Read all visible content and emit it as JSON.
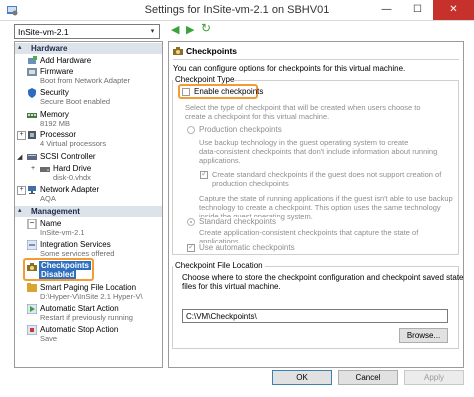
{
  "window": {
    "title": "Settings for InSite-vm-2.1 on SBHV01",
    "minimize_glyph": "—",
    "maximize_glyph": "☐",
    "close_glyph": "✕"
  },
  "vm_selector": {
    "value": "InSite-vm-2.1",
    "arrow": "▾"
  },
  "nav_buttons": {
    "back": "◀",
    "forward": "▶",
    "refresh": "↻"
  },
  "sidebar": {
    "hardware_header": "Hardware",
    "management_header": "Management",
    "expander": "▴",
    "hardware_items": [
      {
        "label": "Add Hardware",
        "sub": ""
      },
      {
        "label": "Firmware",
        "sub": "Boot from Network Adapter"
      },
      {
        "label": "Security",
        "sub": "Secure Boot enabled"
      },
      {
        "label": "Memory",
        "sub": "8192 MB"
      },
      {
        "label": "Processor",
        "sub": "4 Virtual processors"
      },
      {
        "label": "SCSI Controller",
        "sub": ""
      },
      {
        "label": "Hard Drive",
        "sub": "disk-0.vhdx"
      },
      {
        "label": "Network Adapter",
        "sub": "AQA"
      }
    ],
    "management_items": [
      {
        "label": "Name",
        "sub": "InSite-vm-2.1"
      },
      {
        "label": "Integration Services",
        "sub": "Some services offered"
      },
      {
        "label": "Checkpoints",
        "sub": "Disabled"
      },
      {
        "label": "Smart Paging File Location",
        "sub": "D:\\Hyper-V\\InSite 2.1 Hyper-V\\"
      },
      {
        "label": "Automatic Start Action",
        "sub": "Restart if previously running"
      },
      {
        "label": "Automatic Stop Action",
        "sub": "Save"
      }
    ],
    "tree_plus": "+"
  },
  "panel": {
    "title": "Checkpoints",
    "intro": "You can configure options for checkpoints for this virtual machine.",
    "type_group": "Checkpoint Type",
    "enable_label": "Enable checkpoints",
    "enable_checked": false,
    "select_desc_1": "Select the type of checkpoint that will be created when users choose to",
    "select_desc_2": "create a checkpoint for this virtual machine.",
    "production_label": "Production checkpoints",
    "production_desc_1": "Use backup technology in the guest operating system to create",
    "production_desc_2": "data-consistent checkpoints that don't include information about running",
    "production_desc_3": "applications.",
    "create_standard_1": "Create standard checkpoints if the guest does not support creation of",
    "create_standard_2": "production checkpoints",
    "apps_1": "Capture the state of running applications if the guest isn't able to use backup",
    "apps_2": "technology to create a checkpoint. This option uses the same technology",
    "apps_3": "inside the guest operating system.",
    "standard_label": "Standard checkpoints",
    "standard_desc_1": "Create application-consistent checkpoints that capture the state of",
    "standard_desc_2": "applications.",
    "auto_label": "Use automatic checkpoints",
    "location_group": "Checkpoint File Location",
    "location_desc_1": "Choose where to store the checkpoint configuration and checkpoint saved state",
    "location_desc_2": "files for this virtual machine.",
    "location_value": "C:\\VM\\Checkpoints\\",
    "browse_label": "Browse..."
  },
  "footer": {
    "ok": "OK",
    "cancel": "Cancel",
    "apply": "Apply"
  },
  "colors": {
    "accent": "#2f6fbd",
    "highlight": "#f39c33",
    "close": "#c7312b"
  }
}
